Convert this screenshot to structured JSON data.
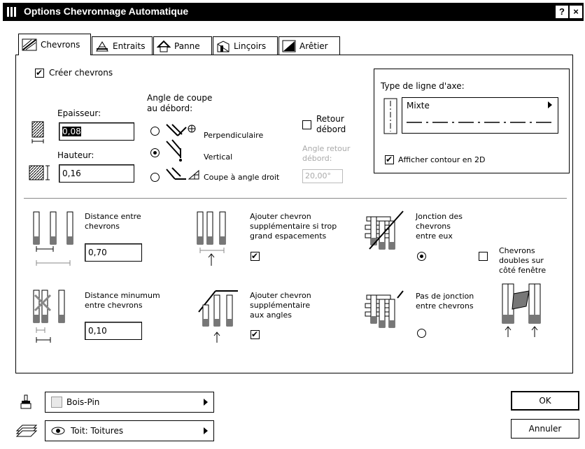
{
  "window": {
    "title": "Options Chevronnage Automatique",
    "help": "?",
    "close": "×"
  },
  "tabs": [
    {
      "label": "Chevrons"
    },
    {
      "label": "Entraits"
    },
    {
      "label": "Panne"
    },
    {
      "label": "Linçoirs"
    },
    {
      "label": "Arêtier"
    }
  ],
  "create": {
    "label": "Créer chevrons",
    "checked": true
  },
  "epaisseur": {
    "label": "Epaisseur:",
    "value": "0,08"
  },
  "hauteur": {
    "label": "Hauteur:",
    "value": "0,16"
  },
  "angle": {
    "label": "Angle de coupe\nau débord:",
    "options": [
      "Perpendiculaire",
      "Vertical",
      "Coupe à angle droit"
    ],
    "selected": 1
  },
  "retour": {
    "label": "Retour\ndébord",
    "checked": false,
    "angle_label": "Angle retour\ndébord:",
    "angle_value": "20,00°"
  },
  "axis": {
    "label": "Type de ligne d'axe:",
    "value": "Mixte",
    "contour_label": "Afficher contour en 2D",
    "contour_checked": true
  },
  "distance": {
    "label": "Distance entre\nchevrons",
    "value": "0,70"
  },
  "dist_min": {
    "label": "Distance minumum\nentre chevrons",
    "value": "0,10"
  },
  "add_extra": {
    "label": "Ajouter chevron\nsupplémentaire si trop\ngrand espacements",
    "checked": true
  },
  "add_angles": {
    "label": "Ajouter chevron\nsupplémentaire\naux angles",
    "checked": true
  },
  "jonction": {
    "label": "Jonction des\nchevrons\nentre eux",
    "selected": true
  },
  "pas_jonction": {
    "label": "Pas de jonction\nentre chevrons",
    "selected": false
  },
  "doubles": {
    "label": "Chevrons\ndoubles sur\ncôté fenêtre",
    "checked": false
  },
  "material": {
    "value": "Bois-Pin"
  },
  "layer": {
    "value": "Toit: Toitures"
  },
  "buttons": {
    "ok": "OK",
    "cancel": "Annuler"
  }
}
